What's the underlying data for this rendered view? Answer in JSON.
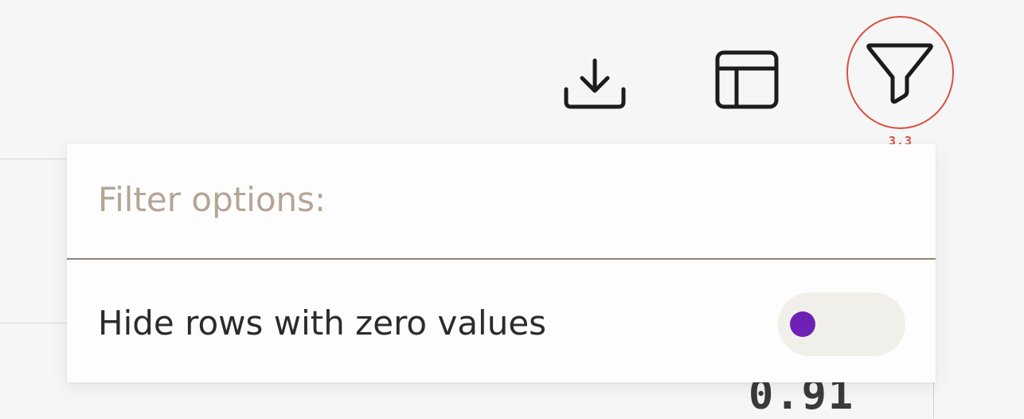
{
  "toolbar": {
    "download_icon": "download-icon",
    "table_icon": "table-layout-icon",
    "filter_icon": "filter-funnel-icon"
  },
  "annotation": {
    "label": "3.3",
    "color": "#d8513e"
  },
  "filter_popup": {
    "title": "Filter options:",
    "options": [
      {
        "label": "Hide rows with zero values",
        "enabled": false
      }
    ]
  },
  "background_table": {
    "visible_value": "0.91"
  },
  "colors": {
    "toggle_knob": "#6e22b5",
    "toggle_track": "#f1efea",
    "title_text": "#b4a595",
    "divider": "#8b8778"
  }
}
